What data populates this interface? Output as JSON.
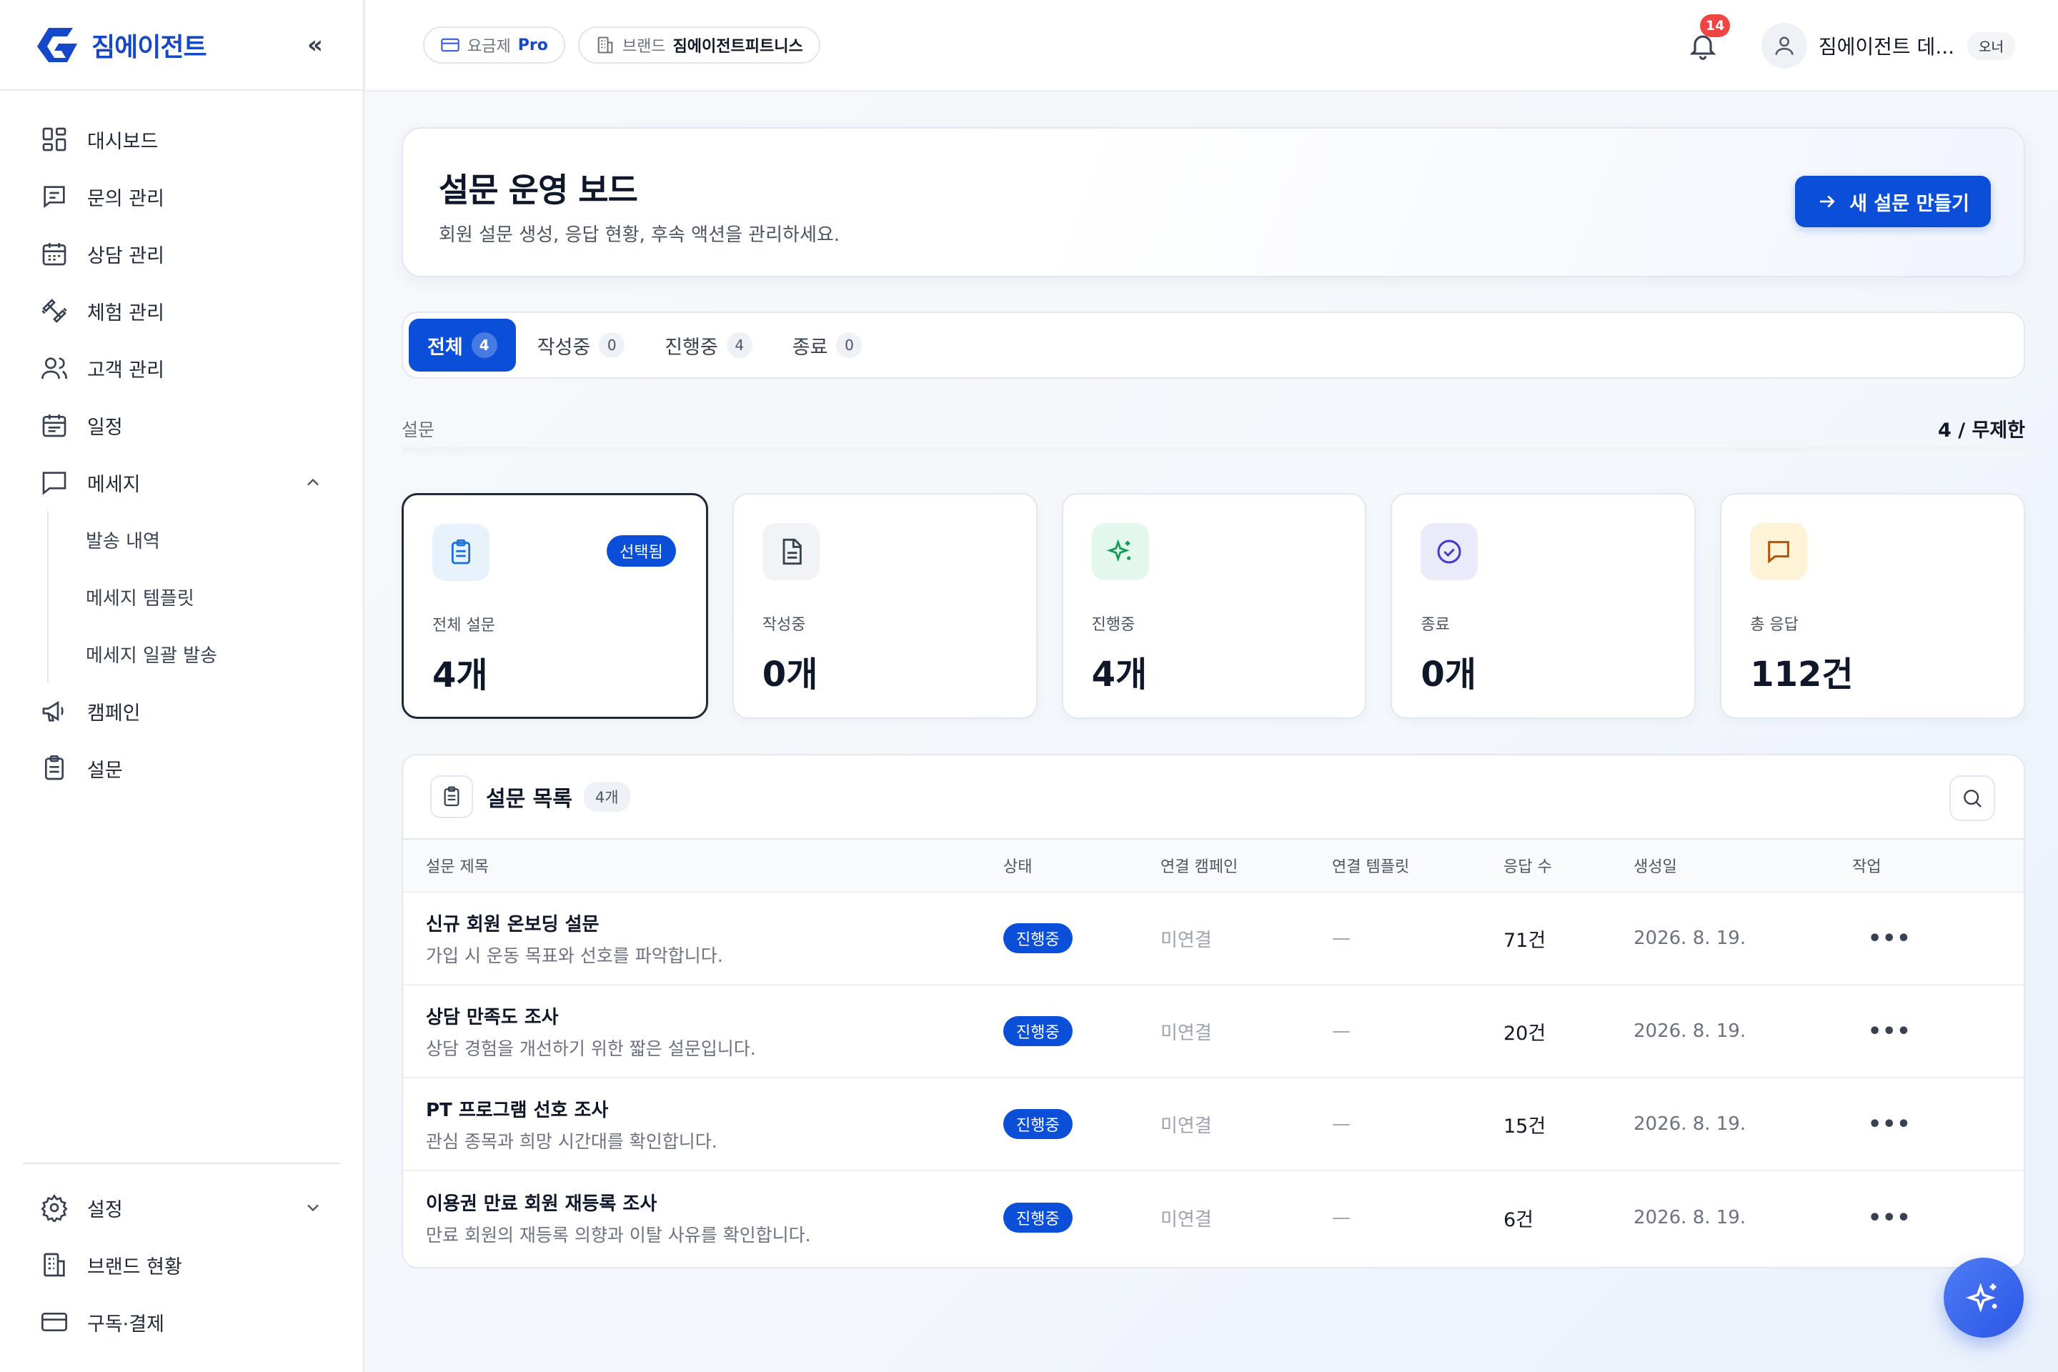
{
  "brand": {
    "name": "짐에이전트",
    "collapse_label": "«"
  },
  "sidebar": {
    "items": [
      {
        "label": "대시보드",
        "icon": "dashboard-icon"
      },
      {
        "label": "문의 관리",
        "icon": "inquiry-icon"
      },
      {
        "label": "상담 관리",
        "icon": "calendar-icon"
      },
      {
        "label": "체험 관리",
        "icon": "dumbbell-icon"
      },
      {
        "label": "고객 관리",
        "icon": "users-icon"
      },
      {
        "label": "일정",
        "icon": "calendar-icon"
      },
      {
        "label": "메세지",
        "icon": "message-icon"
      },
      {
        "label": "캠페인",
        "icon": "megaphone-icon"
      },
      {
        "label": "설문",
        "icon": "clipboard-icon"
      }
    ],
    "message_sub": [
      "발송 내역",
      "메세지 템플릿",
      "메세지 일괄 발송"
    ],
    "bottom": [
      {
        "label": "설정",
        "icon": "gear-icon"
      },
      {
        "label": "브랜드 현황",
        "icon": "building-icon"
      },
      {
        "label": "구독·결제",
        "icon": "credit-card-icon"
      }
    ]
  },
  "topbar": {
    "plan_key": "요금제",
    "plan_value": "Pro",
    "brand_key": "브랜드",
    "brand_value": "짐에이전트피트니스",
    "notification_count": "14",
    "user_name": "짐에이전트 데...",
    "user_role": "오너"
  },
  "hero": {
    "title": "설문 운영 보드",
    "subtitle": "회원 설문 생성, 응답 현황, 후속 액션을 관리하세요.",
    "new_button": "새 설문 만들기"
  },
  "tabs": [
    {
      "label": "전체",
      "count": "4",
      "active": true
    },
    {
      "label": "작성중",
      "count": "0",
      "active": false
    },
    {
      "label": "진행중",
      "count": "4",
      "active": false
    },
    {
      "label": "종료",
      "count": "0",
      "active": false
    }
  ],
  "section": {
    "label": "설문",
    "quota": "4 / 무제한"
  },
  "cards": [
    {
      "label": "전체 설문",
      "value": "4개",
      "badge": "선택됨",
      "icon": "clipboard-icon",
      "color": "#1d6fd8",
      "bg": "#e7f2fd"
    },
    {
      "label": "작성중",
      "value": "0개",
      "badge": "",
      "icon": "document-icon",
      "color": "#374151",
      "bg": "#f1f3f6"
    },
    {
      "label": "진행중",
      "value": "4개",
      "badge": "",
      "icon": "sparkle-icon",
      "color": "#0f9d58",
      "bg": "#e4f7ec"
    },
    {
      "label": "종료",
      "value": "0개",
      "badge": "",
      "icon": "check-circle-icon",
      "color": "#4338ca",
      "bg": "#e9ebfb"
    },
    {
      "label": "총 응답",
      "value": "112건",
      "badge": "",
      "icon": "chat-icon",
      "color": "#b45309",
      "bg": "#fdf3d6"
    }
  ],
  "list": {
    "title": "설문 목록",
    "count": "4개",
    "columns": [
      "설문 제목",
      "상태",
      "연결 캠페인",
      "연결 템플릿",
      "응답 수",
      "생성일",
      "작업"
    ],
    "rows": [
      {
        "title": "신규 회원 온보딩 설문",
        "desc": "가입 시 운동 목표와 선호를 파악합니다.",
        "status": "진행중",
        "campaign": "미연결",
        "template": "—",
        "responses": "71건",
        "date": "2026. 8. 19."
      },
      {
        "title": "상담 만족도 조사",
        "desc": "상담 경험을 개선하기 위한 짧은 설문입니다.",
        "status": "진행중",
        "campaign": "미연결",
        "template": "—",
        "responses": "20건",
        "date": "2026. 8. 19."
      },
      {
        "title": "PT 프로그램 선호 조사",
        "desc": "관심 종목과 희망 시간대를 확인합니다.",
        "status": "진행중",
        "campaign": "미연결",
        "template": "—",
        "responses": "15건",
        "date": "2026. 8. 19."
      },
      {
        "title": "이용권 만료 회원 재등록 조사",
        "desc": "만료 회원의 재등록 의향과 이탈 사유를 확인합니다.",
        "status": "진행중",
        "campaign": "미연결",
        "template": "—",
        "responses": "6건",
        "date": "2026. 8. 19."
      }
    ],
    "more_label": "•••"
  },
  "colors": {
    "accent": "#0b4fd8",
    "brand": "#1747c9",
    "badge_red": "#ef4444"
  }
}
